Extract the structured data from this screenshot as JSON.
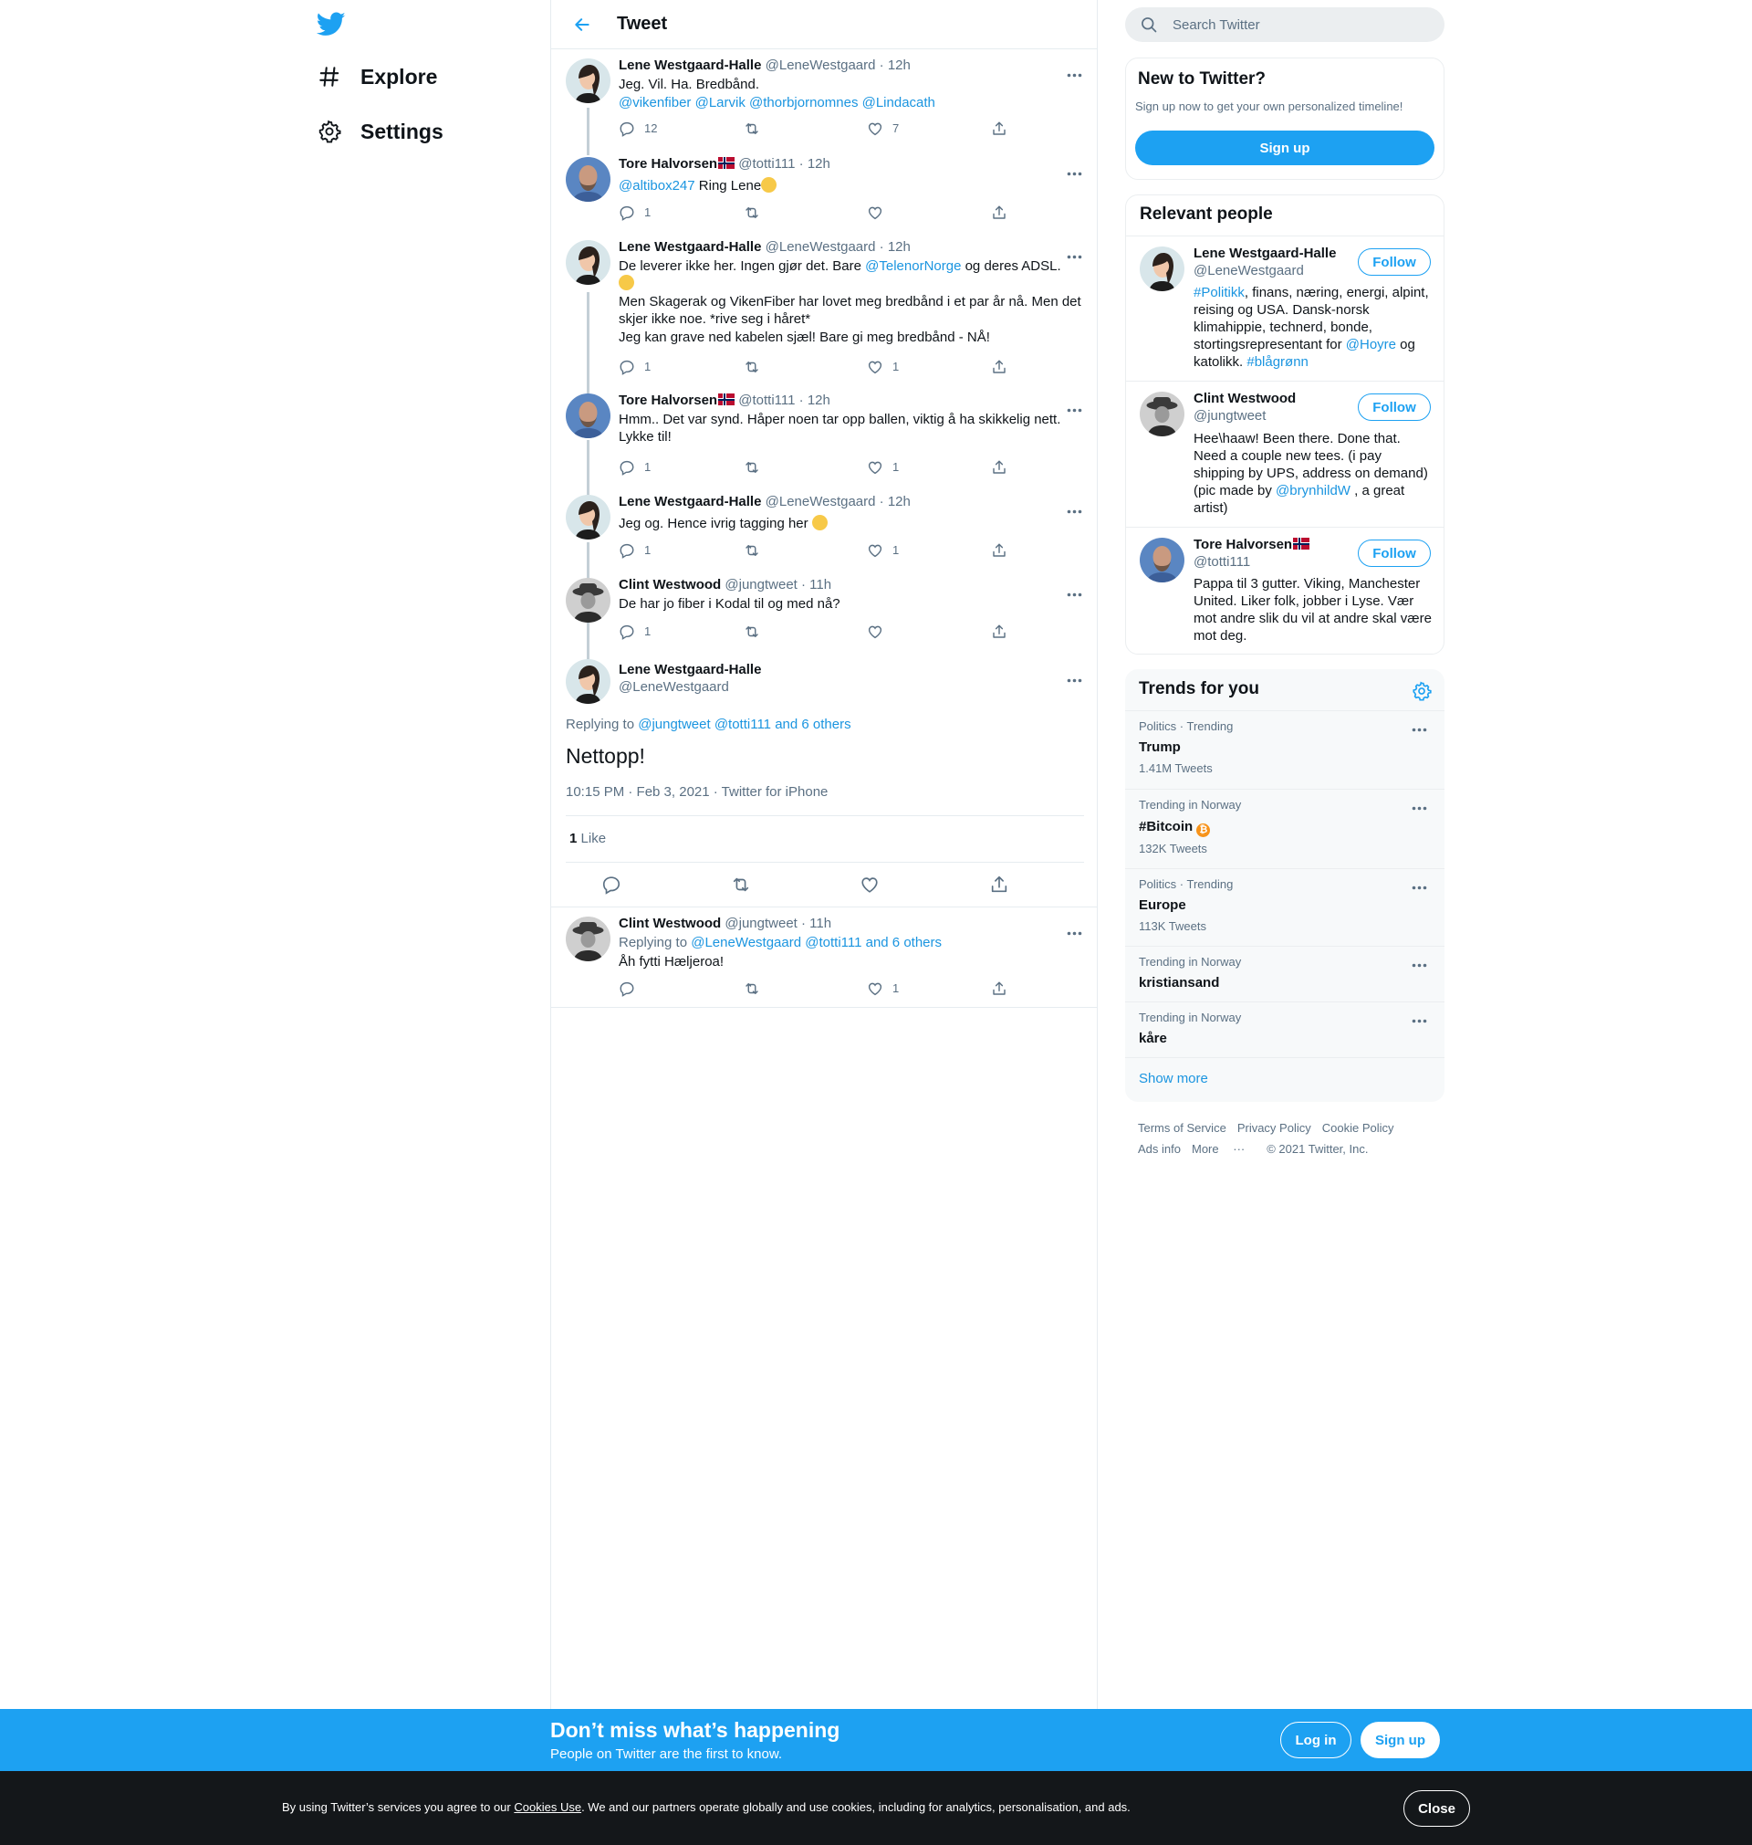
{
  "nav": {
    "explore": "Explore",
    "settings": "Settings"
  },
  "header": {
    "title": "Tweet"
  },
  "tweets": [
    {
      "name": "Lene Westgaard-Halle",
      "handle": "@LeneWestgaard",
      "time": "· 12h",
      "line1": "Jeg. Vil. Ha. Bredbånd.",
      "mentions": "@vikenfiber @Larvik @thorbjornomnes  @Lindacath",
      "replies": "12",
      "retweets": "",
      "likes": "7"
    },
    {
      "name": "Tore Halvorsen",
      "handle": "@totti111",
      "time": "· 12h",
      "mention": "@altibox247",
      "text": " Ring Lene",
      "replies": "1",
      "retweets": "",
      "likes": ""
    },
    {
      "name": "Lene Westgaard-Halle",
      "handle": "@LeneWestgaard",
      "time": "· 12h",
      "text_a": "De leverer ikke her. Ingen gjør det. Bare ",
      "mention": "@TelenorNorge",
      "text_b": " og deres ADSL.",
      "line2": "Men Skagerak og VikenFiber har lovet meg bredbånd i et par år nå. Men det skjer ikke noe. *rive seg i håret*",
      "line3": "Jeg kan grave ned kabelen sjæl! Bare gi meg bredbånd - NÅ!",
      "replies": "1",
      "retweets": "",
      "likes": "1"
    },
    {
      "name": "Tore Halvorsen",
      "handle": "@totti111",
      "time": "· 12h",
      "text": "Hmm.. Det var synd. Håper noen tar opp ballen, viktig å ha skikkelig nett. Lykke til!",
      "replies": "1",
      "retweets": "",
      "likes": "1"
    },
    {
      "name": "Lene Westgaard-Halle",
      "handle": "@LeneWestgaard",
      "time": "· 12h",
      "text": "Jeg og. Hence ivrig tagging her ",
      "replies": "1",
      "retweets": "",
      "likes": "1"
    },
    {
      "name": "Clint Westwood",
      "handle": "@jungtweet",
      "time": "· 11h",
      "text": "De har jo fiber i Kodal til og med nå?",
      "replies": "1",
      "retweets": "",
      "likes": ""
    }
  ],
  "focus": {
    "name": "Lene Westgaard-Halle",
    "handle": "@LeneWestgaard",
    "replying_prefix": "Replying to ",
    "replying_links": "@jungtweet @totti111 and 6 others",
    "text": "Nettopp!",
    "meta": "10:15 PM · Feb 3, 2021 · Twitter for iPhone",
    "like_count": "1",
    "like_label": "Like"
  },
  "reply": {
    "name": "Clint Westwood",
    "handle": "@jungtweet",
    "time": "· 11h",
    "replying_prefix": "Replying to ",
    "replying_links": "@LeneWestgaard @totti111 and 6 others",
    "text": "Åh fytti Hæljeroa!",
    "replies": "",
    "retweets": "",
    "likes": "1"
  },
  "search": {
    "placeholder": "Search Twitter"
  },
  "new_to_twitter": {
    "title": "New to Twitter?",
    "subtitle": "Sign up now to get your own personalized timeline!",
    "signup": "Sign up"
  },
  "relevant": {
    "title": "Relevant people",
    "follow": "Follow",
    "people": [
      {
        "name": "Lene Westgaard-Halle",
        "handle": "@LeneWestgaard",
        "bio_a": "#Politikk",
        "bio_b": ", finans, næring, energi, alpint, reising og USA. Dansk-norsk klimahippie, technerd, bonde, stortingsrepresentant for ",
        "bio_c": "@Hoyre",
        "bio_d": " og katolikk. ",
        "bio_e": "#blågrønn"
      },
      {
        "name": "Clint Westwood",
        "handle": "@jungtweet",
        "bio_a": "Hee\\haaw! Been there. Done that. Need a couple new tees. (i pay shipping by UPS, address on demand) (pic made by ",
        "bio_b": "@brynhildW",
        "bio_c": " , a great artist)"
      },
      {
        "name": "Tore Halvorsen",
        "handle": "@totti111",
        "bio": "Pappa til 3 gutter. Viking, Manchester United. Liker folk, jobber i Lyse. Vær mot andre slik du vil at andre skal være mot deg."
      }
    ]
  },
  "trends": {
    "title": "Trends for you",
    "items": [
      {
        "context": "Politics · Trending",
        "name": "Trump",
        "count": "1.41M Tweets"
      },
      {
        "context": "Trending in Norway",
        "name": "#Bitcoin",
        "count": "132K Tweets"
      },
      {
        "context": "Politics · Trending",
        "name": "Europe",
        "count": "113K Tweets"
      },
      {
        "context": "Trending in Norway",
        "name": "kristiansand",
        "count": ""
      },
      {
        "context": "Trending in Norway",
        "name": "kåre",
        "count": ""
      }
    ],
    "show_more": "Show more"
  },
  "footer": {
    "terms": "Terms of Service",
    "privacy": "Privacy Policy",
    "cookie": "Cookie Policy",
    "ads": "Ads info",
    "more": "More",
    "copyright": "© 2021 Twitter, Inc."
  },
  "promo": {
    "headline": "Don’t miss what’s happening",
    "sub": "People on Twitter are the first to know.",
    "login": "Log in",
    "signup": "Sign up"
  },
  "cookie_bar": {
    "prefix": "By using Twitter’s services you agree to our ",
    "link": "Cookies Use",
    "suffix": ". We and our partners operate globally and use cookies, including for analytics, personalisation, and ads.",
    "close": "Close"
  },
  "colors": {
    "accent": "#1da1f2",
    "link": "#1b95e0",
    "secondary_text": "#5b7083",
    "bitcoin": "#f7931a"
  }
}
